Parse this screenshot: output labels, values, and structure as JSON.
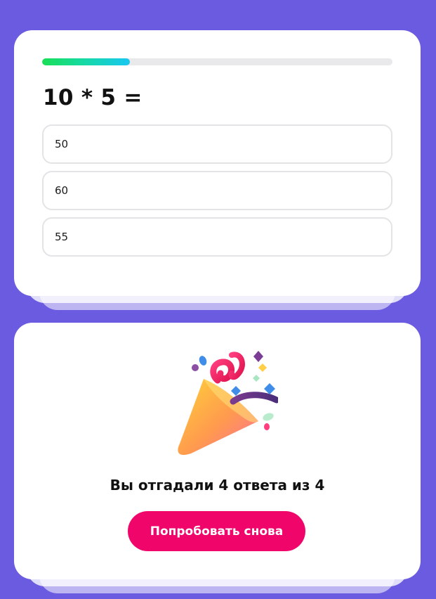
{
  "quiz": {
    "progress": 0.25,
    "question": "10 * 5 =",
    "options": [
      {
        "label": "50"
      },
      {
        "label": "60"
      },
      {
        "label": "55"
      }
    ]
  },
  "result": {
    "icon": "party-popper-icon",
    "message": "Вы отгадали 4 ответа из 4",
    "retry_label": "Попробовать снова"
  },
  "colors": {
    "background": "#6b5be0",
    "card": "#ffffff",
    "progress_start": "#19de56",
    "progress_end": "#19c6f0",
    "button": "#f0066b"
  }
}
